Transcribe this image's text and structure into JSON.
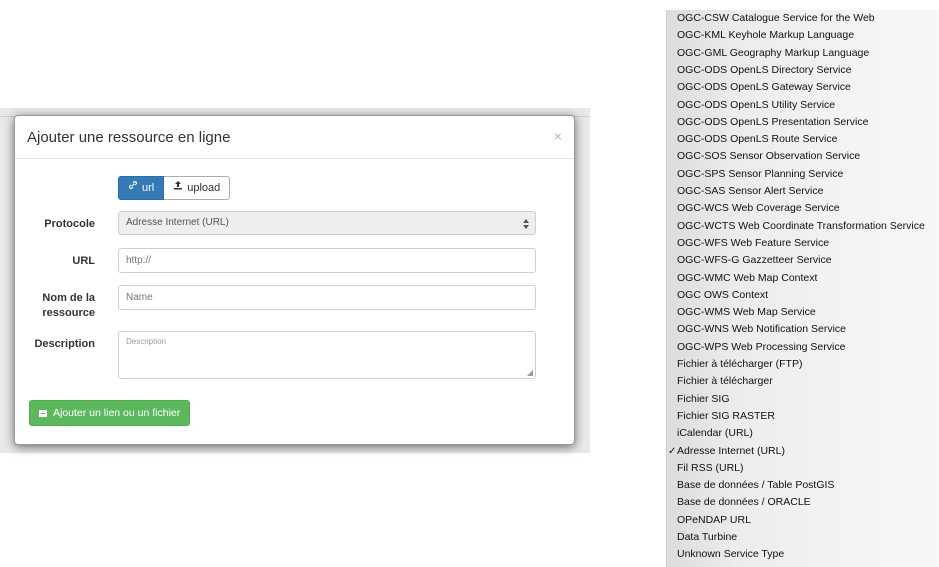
{
  "modal": {
    "title": "Ajouter une ressource en ligne",
    "close": "×",
    "tabs": [
      {
        "label": "url",
        "active": true,
        "icon": "link-icon"
      },
      {
        "label": "upload",
        "active": false,
        "icon": "upload-icon"
      }
    ],
    "fields": {
      "protocol": {
        "label": "Protocole",
        "value": "Adresse Internet (URL)"
      },
      "url": {
        "label": "URL",
        "placeholder": "http://"
      },
      "name": {
        "label_line1": "Nom de la",
        "label_line2": "ressource",
        "placeholder": "Name"
      },
      "description": {
        "label": "Description",
        "placeholder": "Description"
      }
    },
    "submit_label": "Ajouter un lien ou un fichier"
  },
  "dropdown": {
    "selected": "Adresse Internet (URL)",
    "check": "✓",
    "options": [
      "OGC-CSW Catalogue Service for the Web",
      "OGC-KML Keyhole Markup Language",
      "OGC-GML Geography Markup Language",
      "OGC-ODS OpenLS Directory Service",
      "OGC-ODS OpenLS Gateway Service",
      "OGC-ODS OpenLS Utility Service",
      "OGC-ODS OpenLS Presentation Service",
      "OGC-ODS OpenLS Route Service",
      "OGC-SOS Sensor Observation Service",
      "OGC-SPS Sensor Planning Service",
      "OGC-SAS Sensor Alert Service",
      "OGC-WCS Web Coverage Service",
      "OGC-WCTS Web Coordinate Transformation Service",
      "OGC-WFS Web Feature Service",
      "OGC-WFS-G Gazzetteer Service",
      "OGC-WMC Web Map Context",
      "OGC OWS Context",
      "OGC-WMS Web Map Service",
      "OGC-WNS Web Notification Service",
      "OGC-WPS Web Processing Service",
      "Fichier à télécharger (FTP)",
      "Fichier à télécharger",
      "Fichier SIG",
      "Fichier SIG RASTER",
      "iCalendar (URL)",
      "Adresse Internet (URL)",
      "Fil RSS (URL)",
      "Base de données / Table PostGIS",
      "Base de données / ORACLE",
      "OPeNDAP URL",
      "Data Turbine",
      "Unknown Service Type"
    ]
  }
}
